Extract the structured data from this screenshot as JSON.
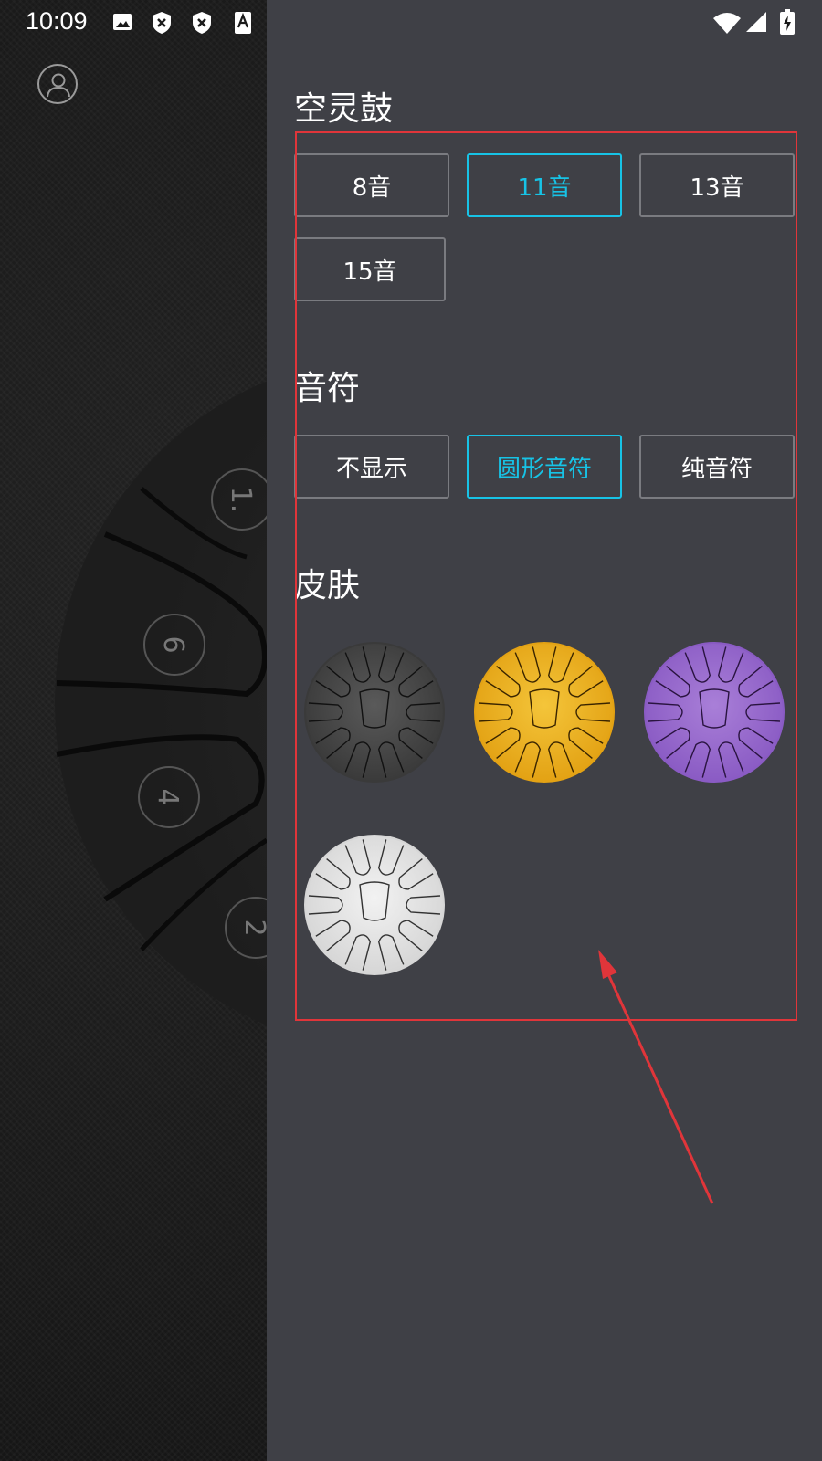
{
  "status_bar": {
    "time": "10:09",
    "left_icons": [
      "image-icon",
      "shield-x-icon",
      "shield-x-icon",
      "a-font-icon"
    ],
    "right_icons": [
      "wifi-icon",
      "signal-icon",
      "battery-charging-icon"
    ]
  },
  "background": {
    "drum_numbers": [
      "1.",
      "6",
      "4",
      "2"
    ]
  },
  "drawer": {
    "sections": {
      "drum": {
        "title": "空灵鼓",
        "options": [
          {
            "label": "8音",
            "selected": false
          },
          {
            "label": "11音",
            "selected": true
          },
          {
            "label": "13音",
            "selected": false
          },
          {
            "label": "15音",
            "selected": false
          }
        ]
      },
      "notes": {
        "title": "音符",
        "options": [
          {
            "label": "不显示",
            "selected": false
          },
          {
            "label": "圆形音符",
            "selected": true
          },
          {
            "label": "纯音符",
            "selected": false
          }
        ]
      },
      "skins": {
        "title": "皮肤",
        "items": [
          {
            "name": "black",
            "base": "#3a3a3a",
            "hi": "#5a5a5a",
            "line": "#111111"
          },
          {
            "name": "gold",
            "base": "#e3a214",
            "hi": "#f4c53a",
            "line": "#3a2500"
          },
          {
            "name": "purple",
            "base": "#8a5bc4",
            "hi": "#a97fd8",
            "line": "#2a1440"
          },
          {
            "name": "silver",
            "base": "#d6d6d6",
            "hi": "#f2f2f2",
            "line": "#333333"
          }
        ]
      }
    }
  },
  "colors": {
    "accent": "#17c3e6",
    "drawer_bg": "#3f4046",
    "annotation": "#e0353a"
  }
}
